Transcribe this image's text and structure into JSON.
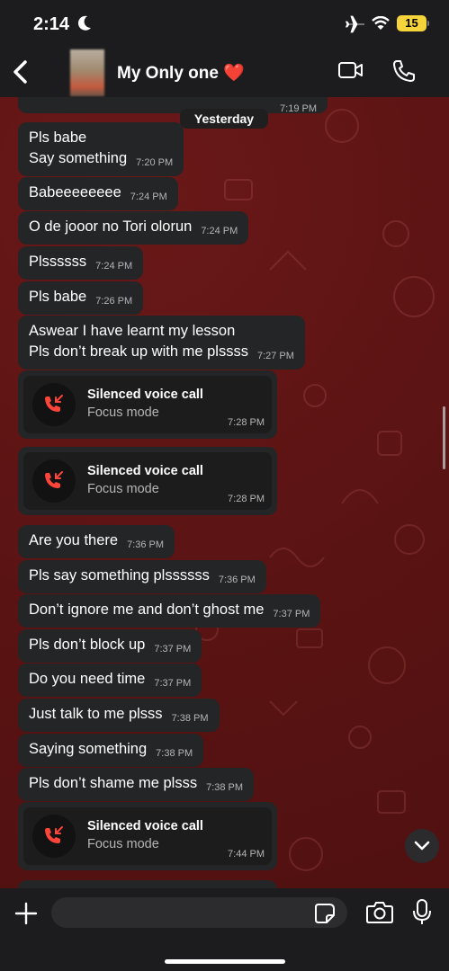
{
  "status_bar": {
    "time": "2:14",
    "battery": "15"
  },
  "header": {
    "contact_name": "My Only one ❤️"
  },
  "chat": {
    "partial_previous_time": "7:19 PM",
    "day_separator": "Yesterday",
    "messages": [
      {
        "type": "text",
        "text": "Pls babe\nSay something",
        "time": "7:20 PM"
      },
      {
        "type": "text",
        "text": "Babeeeeeeee",
        "time": "7:24 PM"
      },
      {
        "type": "text",
        "text": "O de jooor no Tori olorun",
        "time": "7:24 PM"
      },
      {
        "type": "text",
        "text": "Plssssss",
        "time": "7:24 PM"
      },
      {
        "type": "text",
        "text": "Pls babe",
        "time": "7:26 PM"
      },
      {
        "type": "text",
        "text": "Aswear I have learnt my lesson\nPls don’t break up with me plssss",
        "time": "7:27 PM"
      },
      {
        "type": "call",
        "title": "Silenced voice call",
        "subtitle": "Focus mode",
        "time": "7:28 PM"
      },
      {
        "type": "call",
        "title": "Silenced voice call",
        "subtitle": "Focus mode",
        "time": "7:28 PM"
      },
      {
        "type": "text",
        "text": "Are you there",
        "time": "7:36 PM"
      },
      {
        "type": "text",
        "text": "Pls say something plssssss",
        "time": "7:36 PM"
      },
      {
        "type": "text",
        "text": "Don’t ignore me and don’t ghost me",
        "time": "7:37 PM"
      },
      {
        "type": "text",
        "text": "Pls don’t block up",
        "time": "7:37 PM"
      },
      {
        "type": "text",
        "text": "Do you need time",
        "time": "7:37 PM"
      },
      {
        "type": "text",
        "text": "Just talk to me plsss",
        "time": "7:38 PM"
      },
      {
        "type": "text",
        "text": "Saying something",
        "time": "7:38 PM"
      },
      {
        "type": "text",
        "text": "Pls don’t shame me plsss",
        "time": "7:38 PM"
      },
      {
        "type": "call",
        "title": "Silenced voice call",
        "subtitle": "Focus mode",
        "time": "7:44 PM"
      }
    ]
  },
  "composer": {
    "placeholder": "",
    "value": ""
  },
  "icons": [
    "moon-icon",
    "airplane-icon",
    "wifi-icon",
    "back-icon",
    "video-call-icon",
    "phone-call-icon",
    "missed-call-icon",
    "chevron-down-icon",
    "plus-icon",
    "sticker-icon",
    "camera-icon",
    "mic-icon"
  ],
  "colors": {
    "wallpaper": "#5e1414",
    "bubble": "#242526",
    "bar": "#1c1c1e",
    "missed_call_red": "#ff453a",
    "battery_yellow": "#f5d33a"
  }
}
